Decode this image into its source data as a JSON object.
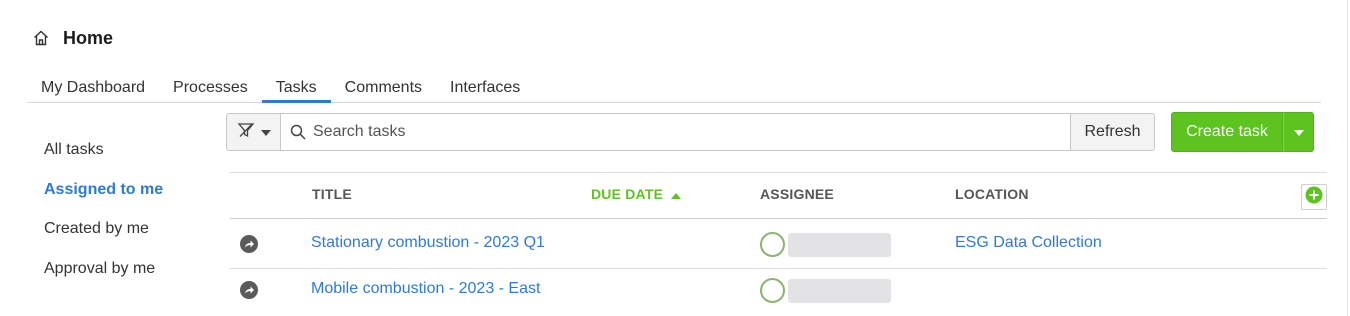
{
  "header": {
    "title": "Home",
    "icon": "home-icon"
  },
  "tabs": [
    {
      "label": "My Dashboard",
      "active": false
    },
    {
      "label": "Processes",
      "active": false
    },
    {
      "label": "Tasks",
      "active": true
    },
    {
      "label": "Comments",
      "active": false
    },
    {
      "label": "Interfaces",
      "active": false
    }
  ],
  "sidebar": {
    "items": [
      {
        "label": "All tasks",
        "active": false
      },
      {
        "label": "Assigned to me",
        "active": true
      },
      {
        "label": "Created by me",
        "active": false
      },
      {
        "label": "Approval by me",
        "active": false
      }
    ]
  },
  "toolbar": {
    "filter_icon": "filter-icon",
    "search_placeholder": "Search tasks",
    "refresh_label": "Refresh",
    "create_label": "Create task"
  },
  "table": {
    "columns": {
      "title": "TITLE",
      "due_date": "DUE DATE",
      "assignee": "ASSIGNEE",
      "location": "LOCATION"
    },
    "sort": {
      "column": "due_date",
      "direction": "ascending"
    },
    "rows": [
      {
        "title": "Stationary combustion - 2023 Q1",
        "location": "ESG Data Collection"
      },
      {
        "title": "Mobile combustion - 2023 - East",
        "location": ""
      }
    ]
  },
  "colors": {
    "accent_blue": "#2f7bd3",
    "primary_green": "#5cc31f",
    "avatar_ring": "#8cb371"
  }
}
